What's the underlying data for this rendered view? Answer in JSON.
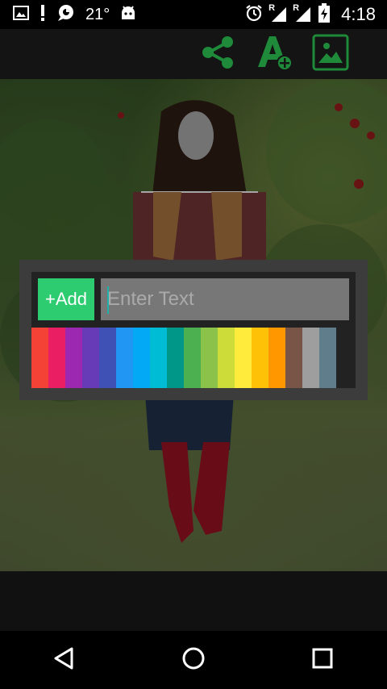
{
  "status_bar": {
    "temperature": "21°",
    "time": "4:18",
    "signal_1_label": "R",
    "signal_2_label": "R",
    "icons": [
      "image-icon",
      "alert-icon",
      "chat-icon",
      "android-icon",
      "alarm-icon",
      "signal-icon",
      "battery-icon"
    ]
  },
  "toolbar": {
    "icons": [
      "share-icon",
      "add-text-icon",
      "image-icon"
    ],
    "accent_color": "#1e8a3a"
  },
  "dialog": {
    "add_label": "+Add",
    "input_placeholder": "Enter Text",
    "input_value": "",
    "palette": [
      "#f44336",
      "#e91e63",
      "#9c27b0",
      "#673ab7",
      "#3f51b5",
      "#2196f3",
      "#03a9f4",
      "#00bcd4",
      "#009688",
      "#4caf50",
      "#8bc34a",
      "#cddc39",
      "#ffeb3b",
      "#ffc107",
      "#ff9800",
      "#795548",
      "#9e9e9e",
      "#607d8b"
    ]
  },
  "nav_bar": {
    "icons": [
      "back-icon",
      "home-icon",
      "recents-icon"
    ]
  }
}
